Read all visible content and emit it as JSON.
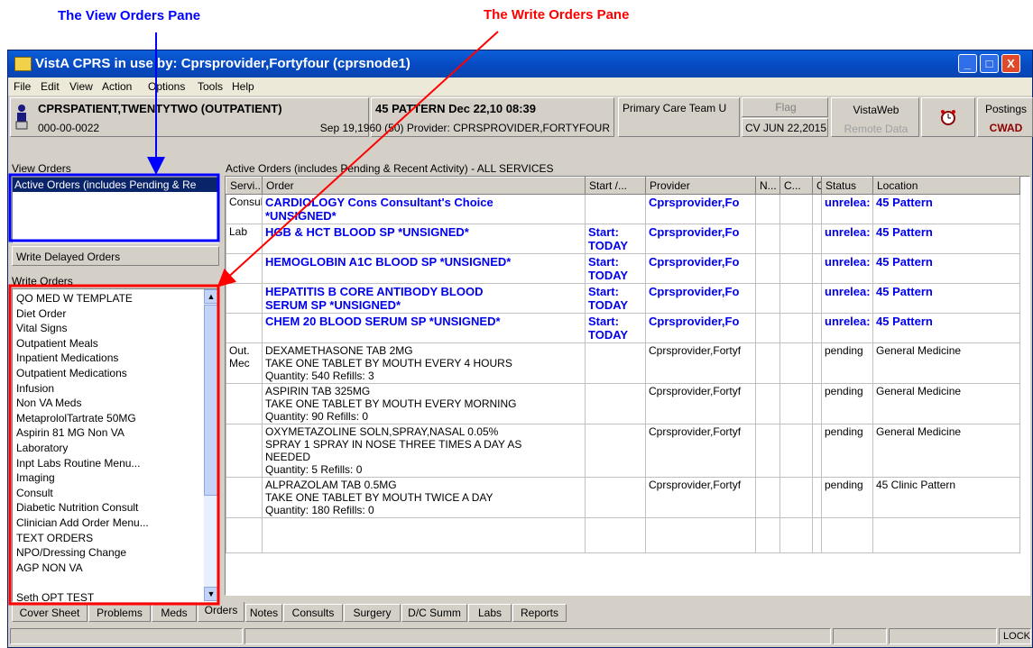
{
  "annotations": {
    "view_orders_label": "The View Orders Pane",
    "write_orders_label": "The Write Orders Pane",
    "view_color": "#0000ff",
    "write_color": "#ff0000"
  },
  "window": {
    "title": "VistA CPRS in use by: Cprsprovider,Fortyfour  (cprsnode1)",
    "minimize": "_",
    "maximize": "□",
    "close": "X"
  },
  "menu": [
    "File",
    "Edit",
    "View",
    "Action",
    "Options",
    "Tools",
    "Help"
  ],
  "patient": {
    "name": "CPRSPATIENT,TWENTYTWO (OUTPATIENT)",
    "ssn": "000-00-0022",
    "location": "45 PATTERN Dec 22,10 08:39",
    "dob_provider": "Sep 19,1960 (50) Provider:  CPRSPROVIDER,FORTYFOUR",
    "team": "Primary Care Team U",
    "flag": "Flag",
    "cv": "CV JUN 22,2015",
    "vistaweb": "VistaWeb",
    "remote": "Remote Data",
    "postings": "Postings",
    "cwad": "CWAD"
  },
  "view_orders": {
    "label": "View Orders",
    "selected": "Active Orders (includes Pending & Re",
    "delayed_button": "Write Delayed Orders"
  },
  "write_orders": {
    "label": "Write Orders",
    "items": [
      "QO MED W TEMPLATE",
      "Diet Order",
      "Vital Signs",
      "Outpatient Meals",
      "Inpatient Medications",
      "Outpatient Medications",
      "Infusion",
      "Non VA Meds",
      "MetaprololTartrate 50MG",
      "Aspirin 81 MG Non VA",
      "Laboratory",
      "Inpt Labs Routine Menu...",
      "Imaging",
      "Consult",
      "Diabetic Nutrition Consult",
      "Clinician Add Order Menu...",
      "TEXT ORDERS",
      "NPO/Dressing Change",
      "AGP NON VA",
      "",
      "Seth OPT TEST"
    ]
  },
  "orders": {
    "caption": "Active Orders (includes Pending & Recent Activity) - ALL SERVICES",
    "columns": [
      "Servi...",
      "Order",
      "Start /...",
      "Provider",
      "N...",
      "C...",
      "C",
      "Status",
      "Location"
    ],
    "rows": [
      {
        "service": "Consults",
        "order": [
          "CARDIOLOGY Cons Consultant's Choice",
          "*UNSIGNED*"
        ],
        "start": "",
        "provider": "Cprsprovider,Fo",
        "status": "unrelea:",
        "location": "45 Pattern",
        "unsigned": true
      },
      {
        "service": "Lab",
        "order": [
          "HGB & HCT BLOOD   SP *UNSIGNED*"
        ],
        "start": "Start: TODAY",
        "provider": "Cprsprovider,Fo",
        "status": "unrelea:",
        "location": "45 Pattern",
        "unsigned": true
      },
      {
        "service": "",
        "order": [
          "HEMOGLOBIN A1C BLOOD   SP *UNSIGNED*"
        ],
        "start": "Start: TODAY",
        "provider": "Cprsprovider,Fo",
        "status": "unrelea:",
        "location": "45 Pattern",
        "unsigned": true
      },
      {
        "service": "",
        "order": [
          "HEPATITIS B CORE ANTIBODY BLOOD",
          "SERUM SP *UNSIGNED*"
        ],
        "start": "Start: TODAY",
        "provider": "Cprsprovider,Fo",
        "status": "unrelea:",
        "location": "45 Pattern",
        "unsigned": true
      },
      {
        "service": "",
        "order": [
          "CHEM 20 BLOOD   SERUM SP *UNSIGNED*"
        ],
        "start": "Start: TODAY",
        "provider": "Cprsprovider,Fo",
        "status": "unrelea:",
        "location": "45 Pattern",
        "unsigned": true
      },
      {
        "service": "Out. Mec",
        "order": [
          "DEXAMETHASONE TAB 2MG",
          "TAKE ONE TABLET BY MOUTH EVERY 4 HOURS",
          "Quantity: 540 Refills: 3"
        ],
        "start": "",
        "provider": "Cprsprovider,Fortyf",
        "status": "pending",
        "location": "General Medicine",
        "unsigned": false
      },
      {
        "service": "",
        "order": [
          "ASPIRIN TAB 325MG",
          "TAKE ONE TABLET BY MOUTH EVERY MORNING",
          "Quantity: 90 Refills: 0"
        ],
        "start": "",
        "provider": "Cprsprovider,Fortyf",
        "status": "pending",
        "location": "General Medicine",
        "unsigned": false
      },
      {
        "service": "",
        "order": [
          "OXYMETAZOLINE SOLN,SPRAY,NASAL 0.05%",
          "SPRAY 1 SPRAY IN NOSE THREE TIMES A DAY AS",
          "NEEDED",
          "Quantity: 5 Refills: 0"
        ],
        "start": "",
        "provider": "Cprsprovider,Fortyf",
        "status": "pending",
        "location": "General Medicine",
        "unsigned": false
      },
      {
        "service": "",
        "order": [
          "ALPRAZOLAM TAB 0.5MG",
          "TAKE ONE TABLET BY MOUTH TWICE A DAY",
          "Quantity: 180 Refills: 0"
        ],
        "start": "",
        "provider": "Cprsprovider,Fortyf",
        "status": "pending",
        "location": "45 Clinic Pattern",
        "unsigned": false
      }
    ]
  },
  "tabs": [
    "Cover Sheet",
    "Problems",
    "Meds",
    "Orders",
    "Notes",
    "Consults",
    "Surgery",
    "D/C Summ",
    "Labs",
    "Reports"
  ],
  "active_tab": "Orders",
  "statusbar": {
    "lock": "LOCK"
  }
}
